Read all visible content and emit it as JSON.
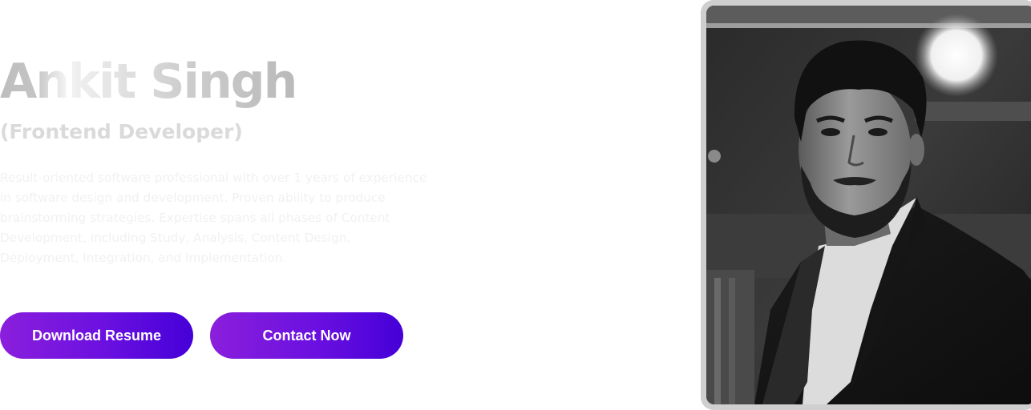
{
  "hero": {
    "name": "Ankit Singh",
    "role": "(Frontend Developer)",
    "bio": "Result-oriented software professional with over 1 years of experience in software design and development. Proven ability to produce brainstorming strategies. Expertise spans all phases of Content Development, including Study, Analysis, Content Design, Deployment, Integration, and Implementation.",
    "buttons": {
      "resume_label": "Download Resume",
      "contact_label": "Contact Now"
    }
  },
  "colors": {
    "button_gradient_start": "#8b1fdc",
    "button_gradient_end": "#4500d8",
    "frame": "#cfcfcf"
  },
  "photo": {
    "style": "black-and-white portrait"
  }
}
